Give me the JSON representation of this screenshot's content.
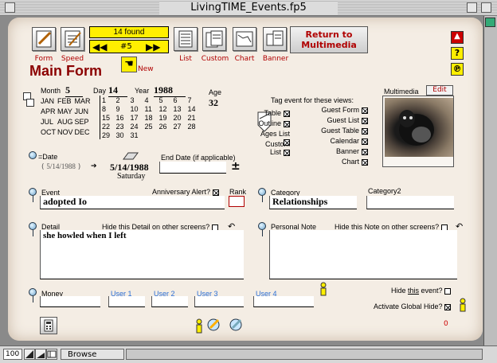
{
  "window": {
    "title": "LivingTIME_Events.fp5"
  },
  "toolbar": {
    "form_label": "Form",
    "speed_label": "Speed",
    "found": "14 found",
    "record": "#5",
    "new_label": "New",
    "list_label": "List",
    "custom_label": "Custom",
    "chart_label": "Chart",
    "banner_label": "Banner",
    "return_label": "Return to Multimedia"
  },
  "page_title": "Main Form",
  "date": {
    "month_label": "Month",
    "month": "5",
    "day_label": "Day",
    "day": "14",
    "year_label": "Year",
    "year": "1988",
    "age_label": "Age",
    "age": "32",
    "months": [
      [
        "JAN",
        "FEB",
        "MAR"
      ],
      [
        "APR",
        "MAY",
        "JUN"
      ],
      [
        "JUL",
        "AUG",
        "SEP"
      ],
      [
        "OCT",
        "NOV",
        "DEC"
      ]
    ],
    "days": [
      [
        "1",
        "2",
        "3",
        "4",
        "5",
        "6",
        "7"
      ],
      [
        "8",
        "9",
        "10",
        "11",
        "12",
        "13",
        "14"
      ],
      [
        "15",
        "16",
        "17",
        "18",
        "19",
        "20",
        "21"
      ],
      [
        "22",
        "23",
        "24",
        "25",
        "26",
        "27",
        "28"
      ],
      [
        "29",
        "30",
        "31",
        "",
        "",
        "",
        ""
      ]
    ],
    "eq_date_label": "=Date",
    "eq_date_value": "5/14/1988",
    "main_date": "5/14/1988",
    "weekday": "Saturday",
    "end_date_label": "End Date (if applicable)",
    "plusminus": "±"
  },
  "tags": {
    "header": "Tag event for these views:",
    "left": [
      {
        "label": "Table",
        "checked": true
      },
      {
        "label": "Outline",
        "checked": true
      },
      {
        "label": "Ages List",
        "checked": true
      },
      {
        "label": "Custom List",
        "checked": true
      }
    ],
    "right": [
      {
        "label": "Guest Form",
        "checked": true
      },
      {
        "label": "Guest List",
        "checked": true
      },
      {
        "label": "Guest Table",
        "checked": true
      },
      {
        "label": "Calendar",
        "checked": true
      },
      {
        "label": "Banner",
        "checked": true
      },
      {
        "label": "Chart",
        "checked": true
      }
    ]
  },
  "multimedia": {
    "label": "Multimedia",
    "edit_label": "Edit"
  },
  "event": {
    "label": "Event",
    "value": "adopted Io",
    "anniversary_label": "Anniversary Alert?",
    "rank_label": "Rank"
  },
  "category": {
    "label": "Category",
    "value": "Relationships",
    "category2_label": "Category2"
  },
  "detail": {
    "label": "Detail",
    "hide_label": "Hide this Detail on other screens?",
    "value": "she howled when I left"
  },
  "personal_note": {
    "label": "Personal Note",
    "hide_label": "Hide this Note on other screens?"
  },
  "bottom": {
    "money_label": "Money",
    "user1": "User 1",
    "user2": "User 2",
    "user3": "User 3",
    "user4": "User 4",
    "hide_event_prefix": "Hide ",
    "hide_event_this": "this",
    "hide_event_suffix": " event?",
    "global_hide_label": "Activate Global Hide?",
    "counter": "0"
  },
  "status": {
    "zoom": "100",
    "mode": "Browse"
  }
}
